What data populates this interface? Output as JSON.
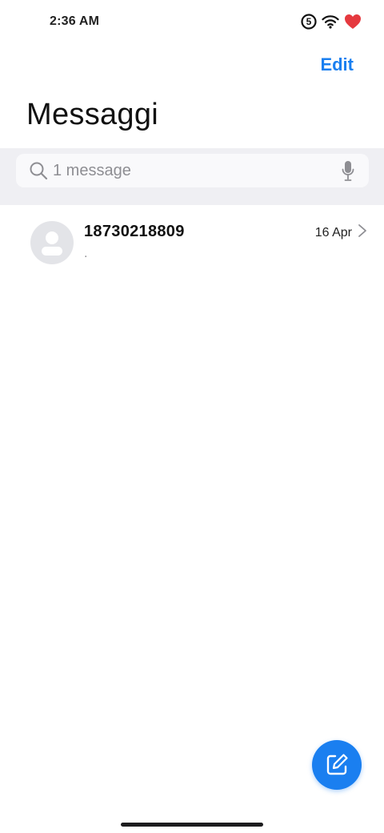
{
  "status_bar": {
    "time": "2:36 AM",
    "icons": [
      "sim-5-icon",
      "wifi-icon",
      "heart-battery-icon"
    ],
    "sim_label": "5"
  },
  "header": {
    "edit_label": "Edit",
    "title": "Messaggi"
  },
  "search": {
    "placeholder": "1 message",
    "icon": "search-icon",
    "voice_icon": "mic-icon"
  },
  "messages": [
    {
      "sender": "18730218809",
      "preview": ".",
      "date": "16 Apr",
      "avatar_icon": "person-icon"
    }
  ],
  "compose": {
    "icon": "compose-icon"
  },
  "colors": {
    "accent": "#1a7ff0",
    "search_band": "#efeff3",
    "avatar_bg": "#e3e4e8",
    "heart": "#e5393f"
  }
}
